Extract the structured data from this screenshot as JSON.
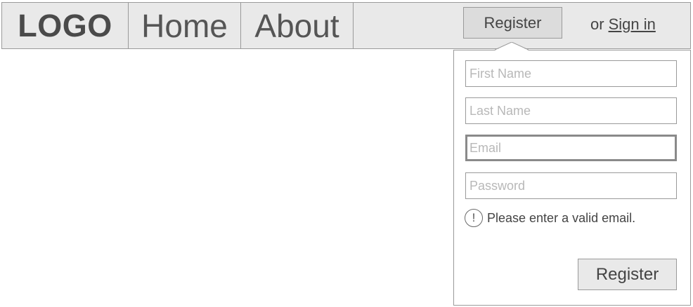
{
  "navbar": {
    "logo": "LOGO",
    "links": [
      {
        "label": "Home"
      },
      {
        "label": "About"
      }
    ],
    "register_button": "Register",
    "signin_prefix": "or",
    "signin_link": "Sign in"
  },
  "register_form": {
    "fields": {
      "first_name": {
        "placeholder": "First Name",
        "value": ""
      },
      "last_name": {
        "placeholder": "Last Name",
        "value": ""
      },
      "email": {
        "placeholder": "Email",
        "value": ""
      },
      "password": {
        "placeholder": "Password",
        "value": ""
      }
    },
    "error": {
      "icon": "exclamation-circle-icon",
      "symbol": "!",
      "message": "Please enter a valid email."
    },
    "submit_label": "Register"
  },
  "colors": {
    "bar_background": "#e9e9e9",
    "border": "#9a9a9a",
    "button_active": "#dcdcdc"
  }
}
